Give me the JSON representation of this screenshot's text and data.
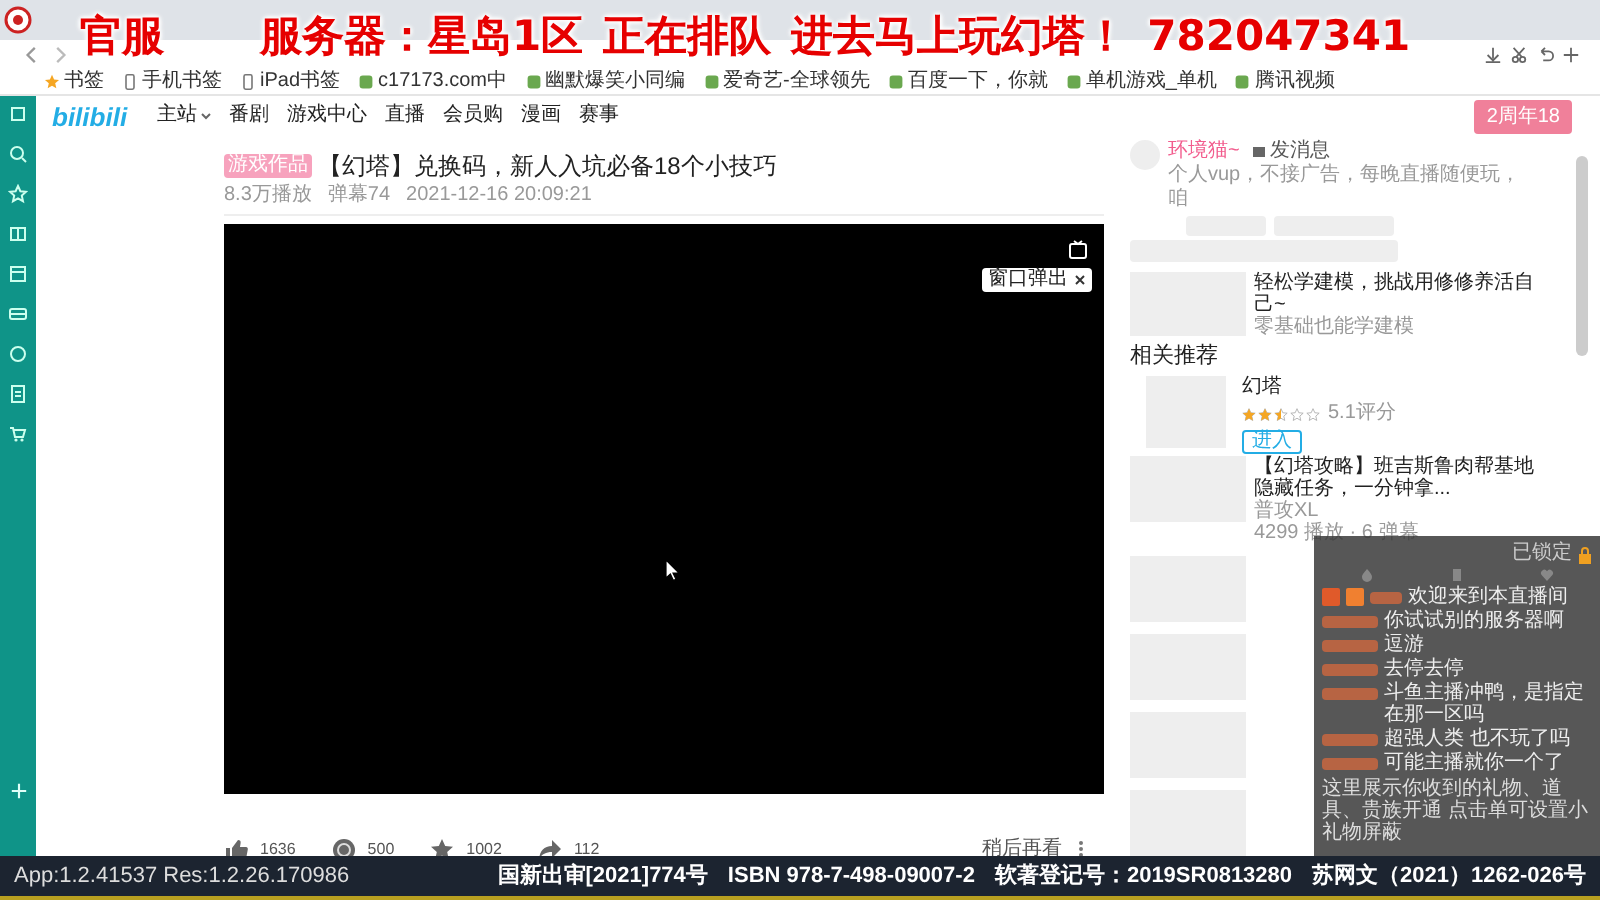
{
  "overlay_banner": [
    "官服",
    "服务器：星岛1区",
    "正在排队",
    "进去马上玩幻塔！",
    "782047341"
  ],
  "bookmarks": [
    {
      "label": "书签",
      "kind": "star"
    },
    {
      "label": "手机书签",
      "kind": "device"
    },
    {
      "label": "iPad书签",
      "kind": "device"
    },
    {
      "label": "c17173.com中",
      "kind": "site"
    },
    {
      "label": "幽默爆笑小同编",
      "kind": "site"
    },
    {
      "label": "爱奇艺-全球领先",
      "kind": "site"
    },
    {
      "label": "百度一下，你就",
      "kind": "site"
    },
    {
      "label": "单机游戏_单机",
      "kind": "site"
    },
    {
      "label": "腾讯视频",
      "kind": "site"
    }
  ],
  "site": {
    "logo": "bilibili",
    "nav": [
      {
        "label": "主站",
        "dropdown": true
      },
      {
        "label": "番剧",
        "dropdown": false
      },
      {
        "label": "游戏中心",
        "dropdown": false
      },
      {
        "label": "直播",
        "dropdown": false
      },
      {
        "label": "会员购",
        "dropdown": false
      },
      {
        "label": "漫画",
        "dropdown": false
      },
      {
        "label": "赛事",
        "dropdown": false
      }
    ],
    "promo_button": "2周年18"
  },
  "video": {
    "tag": "游戏作品",
    "title": "【幻塔】兑换码，新人入坑必备18个小技巧",
    "meta": [
      "8.3万播放",
      "弹幕74",
      "2021-12-16 20:09:21"
    ],
    "popout_button": "窗口弹出",
    "actions": [
      {
        "kind": "like",
        "count": "1636"
      },
      {
        "kind": "coin",
        "count": "500"
      },
      {
        "kind": "favorite",
        "count": "1002"
      },
      {
        "kind": "share",
        "count": "112"
      }
    ],
    "watch_later": "稍后再看"
  },
  "uploader": {
    "name": "环境猫~",
    "message_button": "发消息",
    "bio": "个人vup，不接广告，每晚直播随便玩，咱"
  },
  "ad": {
    "title": "轻松学建模，挑战用修修养活自己~",
    "source": "零基础也能学建模"
  },
  "related": {
    "heading": "相关推荐",
    "game": {
      "name": "幻塔",
      "stars": 2.5,
      "rating": "5.1评分",
      "button": "进入"
    },
    "videos": [
      {
        "title": "【幻塔攻略】班吉斯鲁肉帮基地隐藏任务，一分钟拿...",
        "author": "普攻XL",
        "stats": "4299 播放 · 6 弹幕"
      }
    ]
  },
  "chat": {
    "locked_label": "已锁定",
    "messages": [
      {
        "kind": "welcome",
        "text": "欢迎来到本直播间"
      },
      {
        "kind": "user",
        "text": "你试试别的服务器啊"
      },
      {
        "kind": "user",
        "text": "逗游"
      },
      {
        "kind": "user",
        "text": "去停去停"
      },
      {
        "kind": "user",
        "text": "斗鱼主播冲鸭，是指定在那一区吗"
      },
      {
        "kind": "user",
        "text": "超强人类 也不玩了吗"
      },
      {
        "kind": "user",
        "text": "可能主播就你一个了"
      }
    ],
    "system_note": "这里展示你收到的礼物、道具、贵族开通 点击单可设置小礼物屏蔽"
  },
  "status_bar": {
    "version": "App:1.2.41537 Res:1.2.26.170986",
    "license": [
      "国新出审[2021]774号",
      "ISBN 978-7-498-09007-2",
      "软著登记号：2019SR0813280",
      "苏网文（2021）1262-026号"
    ]
  }
}
